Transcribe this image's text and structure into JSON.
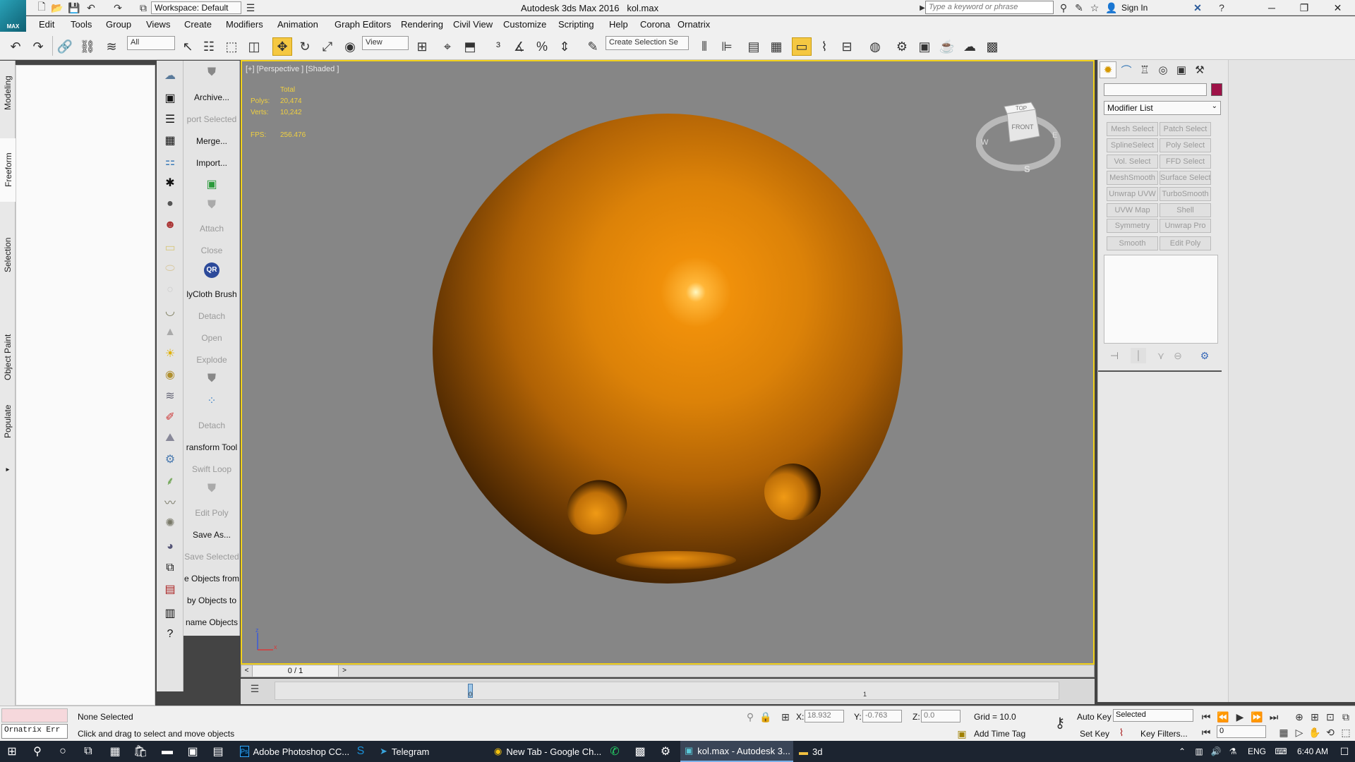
{
  "title_bar": {
    "app_title": "Autodesk 3ds Max 2016",
    "file_name": "kol.max",
    "workspace_value": "Workspace: Default",
    "search_placeholder": "Type a keyword or phrase",
    "sign_in": "Sign In",
    "logo_label": "MAX"
  },
  "menu": {
    "items": [
      "Edit",
      "Tools",
      "Group",
      "Views",
      "Create",
      "Modifiers",
      "Animation",
      "Graph Editors",
      "Rendering",
      "Civil View",
      "Customize",
      "Scripting",
      "Help",
      "Corona",
      "Ornatrix"
    ]
  },
  "main_toolbar": {
    "selection_filter": "All",
    "ref_coord": "View",
    "named_selection": "Create Selection Se"
  },
  "ribbon": {
    "tabs": [
      "Modeling",
      "Freeform",
      "Selection",
      "Object Paint",
      "Populate"
    ],
    "active_tab": "Freeform"
  },
  "command_strip": {
    "items": [
      {
        "label": "Archive...",
        "enabled": true
      },
      {
        "label": "port Selected",
        "enabled": false
      },
      {
        "label": "Merge...",
        "enabled": true
      },
      {
        "label": "Import...",
        "enabled": true
      },
      {
        "label": "Attach",
        "enabled": false
      },
      {
        "label": "Close",
        "enabled": false
      },
      {
        "label": "lyCloth Brush",
        "enabled": true
      },
      {
        "label": "Detach",
        "enabled": false
      },
      {
        "label": "Open",
        "enabled": false
      },
      {
        "label": "Explode",
        "enabled": false
      },
      {
        "label": "Detach",
        "enabled": false
      },
      {
        "label": "ransform Tool",
        "enabled": true
      },
      {
        "label": "Swift Loop",
        "enabled": false
      },
      {
        "label": "Edit Poly",
        "enabled": false
      },
      {
        "label": "Save As...",
        "enabled": true
      },
      {
        "label": "Save Selected",
        "enabled": false
      },
      {
        "label": "e Objects from",
        "enabled": true
      },
      {
        "label": "by Objects to",
        "enabled": true
      },
      {
        "label": "name Objects",
        "enabled": true
      }
    ],
    "qr_label": "QR"
  },
  "viewport": {
    "label": "[+] [Perspective ] [Shaded ]",
    "stats": {
      "total_label": "Total",
      "polys_label": "Polys:",
      "polys_value": "20,474",
      "verts_label": "Verts:",
      "verts_value": "10,242",
      "fps_label": "FPS:",
      "fps_value": "256.476"
    },
    "viewcube": {
      "top": "TOP",
      "front": "FRONT",
      "west": "W",
      "east": "E",
      "south": "S"
    },
    "axis": {
      "z": "z",
      "x": "x"
    },
    "sphere_color": "#dc8208",
    "border_color": "#f3d21a"
  },
  "timeline": {
    "frame_counter": "0 / 1",
    "tick_0": "0",
    "tick_1": "1"
  },
  "command_panel": {
    "modifier_list": "Modifier List",
    "color_swatch": "#9e1248",
    "modifier_buttons": [
      "Mesh Select",
      "Patch Select",
      "SplineSelect",
      "Poly Select",
      "Vol. Select",
      "FFD Select",
      "MeshSmooth",
      "Surface Select",
      "Unwrap UVW",
      "TurboSmooth",
      "UVW Map",
      "Shell",
      "Symmetry",
      "Unwrap Pro",
      "Smooth",
      "Edit Poly"
    ]
  },
  "status": {
    "maxscript_label": "Ornatrix Err",
    "selection_status": "None Selected",
    "prompt": "Click and drag to select and move objects",
    "x_label": "X:",
    "x_value": "18.932",
    "y_label": "Y:",
    "y_value": "-0.763",
    "z_label": "Z:",
    "z_value": "0.0",
    "grid": "Grid = 10.0",
    "add_time_tag": "Add Time Tag",
    "auto_key": "Auto Key",
    "set_key": "Set Key",
    "key_mode": "Selected",
    "key_filters": "Key Filters...",
    "frame_value": "0"
  },
  "taskbar": {
    "apps": [
      "Adobe Photoshop CC...",
      "Telegram",
      "New Tab - Google Ch...",
      "kol.max - Autodesk 3...",
      "3d"
    ],
    "active_app": "kol.max - Autodesk 3...",
    "language": "ENG",
    "time": "6:40 AM"
  }
}
